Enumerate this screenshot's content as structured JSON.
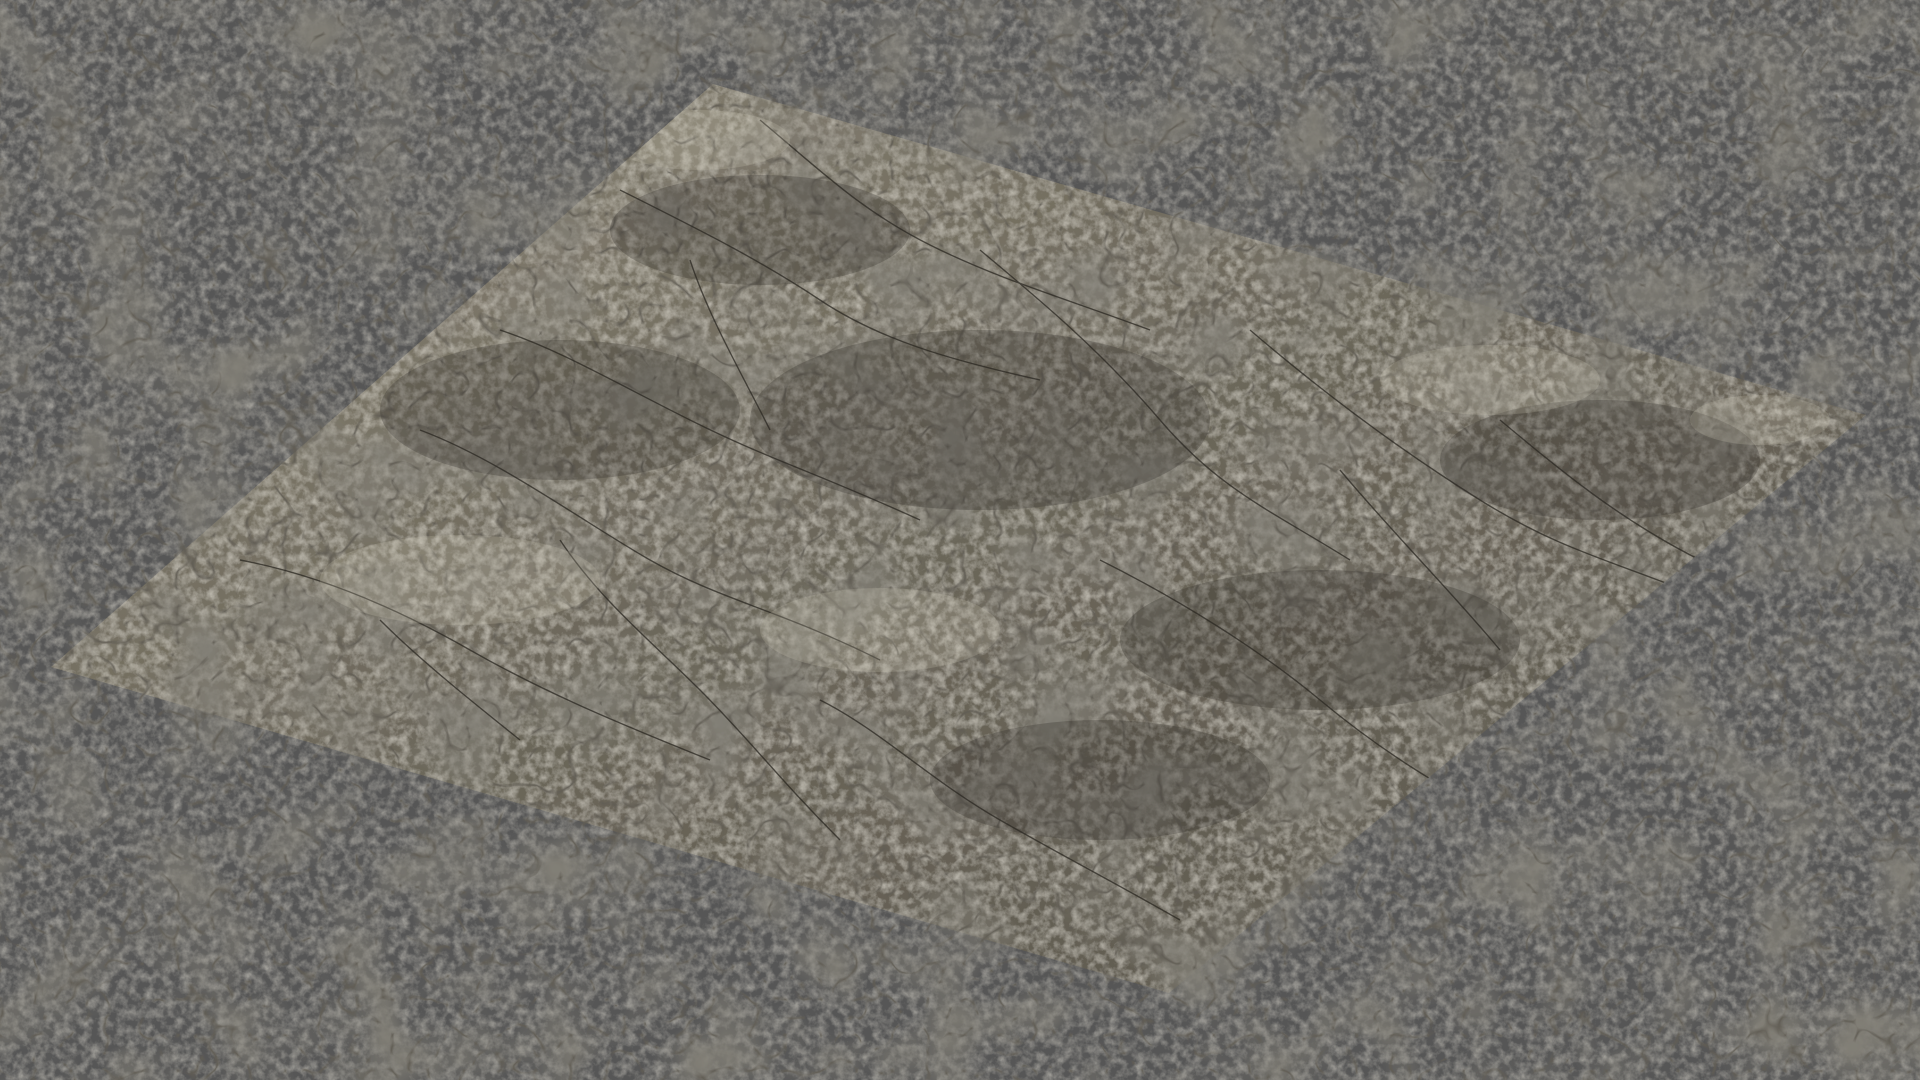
{
  "scene": {
    "background_color": "#565656",
    "object": "textured-ground-plane",
    "material": "cracked-rock",
    "texture_colors": {
      "base": "#777063",
      "light": "#a7a191",
      "dark": "#3f3b33",
      "crack": "#26231e"
    }
  }
}
